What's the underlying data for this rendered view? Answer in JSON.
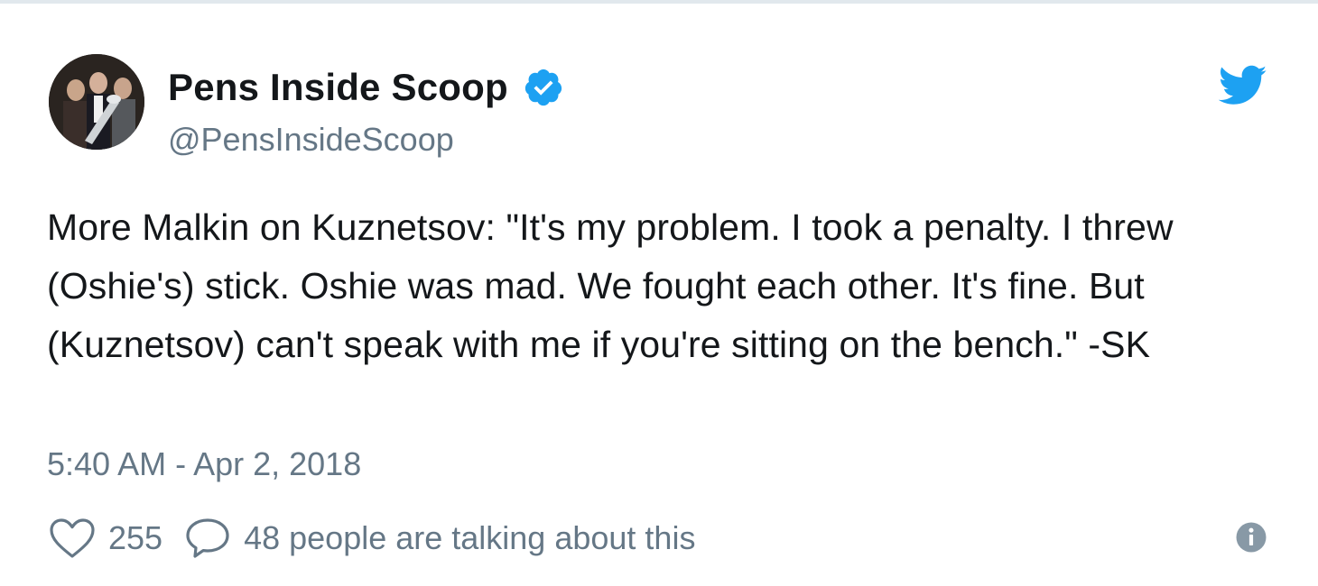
{
  "tweet": {
    "display_name": "Pens Inside Scoop",
    "handle": "@PensInsideScoop",
    "text": "More Malkin on Kuznetsov: \"It's my problem. I took a penalty. I threw (Oshie's) stick. Oshie was mad. We fought each other. It's fine. But (Kuznetsov) can't speak with me if you're sitting on the bench.\" -SK",
    "timestamp": "5:40 AM - Apr 2, 2018",
    "likes": "255",
    "talking": "48 people are talking about this"
  },
  "icons": {
    "verified": "verified-badge-icon",
    "twitter_logo": "twitter-bird-icon",
    "like": "heart-icon",
    "reply": "speech-bubble-icon",
    "info": "info-icon"
  },
  "colors": {
    "brand_blue": "#1da1f2",
    "muted_text": "#657786",
    "body_text": "#14171a",
    "border": "#e1e8ed"
  }
}
